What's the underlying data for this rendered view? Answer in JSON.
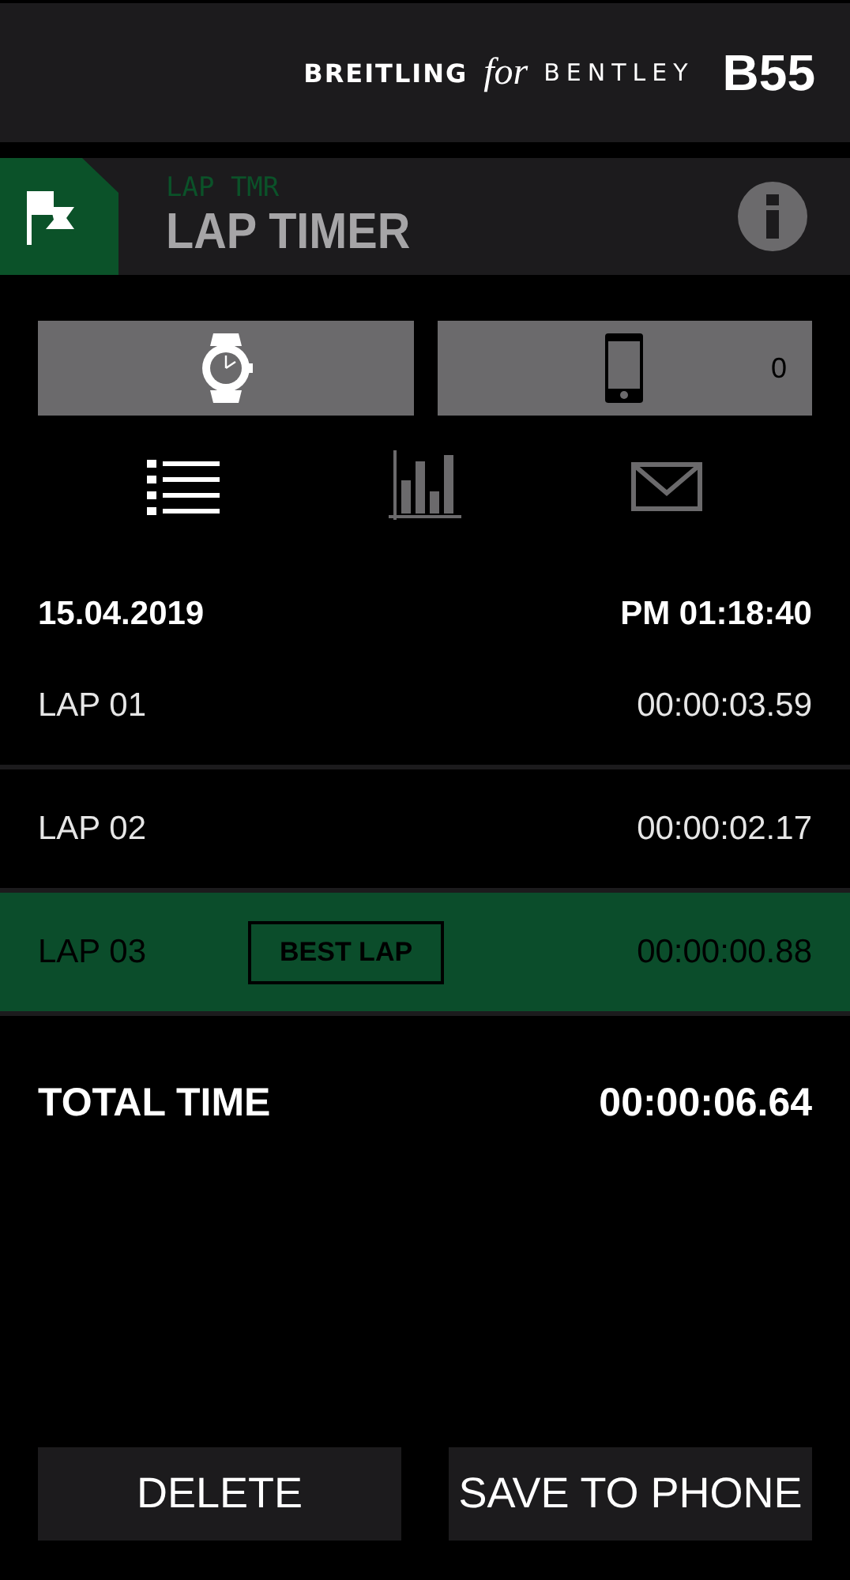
{
  "header": {
    "brand": "BREITLING",
    "connector": "for",
    "partner": "BENTLEY",
    "model": "B55"
  },
  "title_bar": {
    "subtitle": "LAP TMR",
    "title": "LAP TIMER"
  },
  "sources": [
    {
      "kind": "watch",
      "selected": false
    },
    {
      "kind": "phone",
      "count": "0",
      "selected": false
    }
  ],
  "tabs": [
    {
      "kind": "list",
      "selected": true
    },
    {
      "kind": "chart",
      "selected": false
    },
    {
      "kind": "mail",
      "selected": false
    }
  ],
  "session": {
    "date": "15.04.2019",
    "time": "PM 01:18:40"
  },
  "laps": [
    {
      "name": "LAP 01",
      "time": "00:00:03.59",
      "best": false
    },
    {
      "name": "LAP 02",
      "time": "00:00:02.17",
      "best": false
    },
    {
      "name": "LAP 03",
      "time": "00:00:00.88",
      "best": true,
      "badge": "BEST LAP"
    }
  ],
  "total": {
    "label": "TOTAL TIME",
    "time": "00:00:06.64"
  },
  "buttons": [
    "DELETE",
    "SAVE TO PHONE"
  ]
}
